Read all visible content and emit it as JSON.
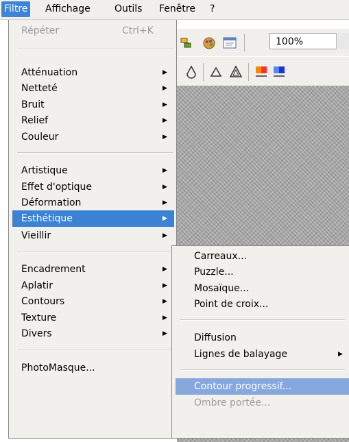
{
  "menubar": {
    "items": [
      "Filtre",
      "Affichage",
      "Outils",
      "Fenêtre",
      "?"
    ]
  },
  "toolbar": {
    "zoom": "100%"
  },
  "filter_menu": {
    "repeat": {
      "label": "Répéter",
      "shortcut": "Ctrl+K"
    },
    "items": [
      "Atténuation",
      "Netteté",
      "Bruit",
      "Relief",
      "Couleur",
      "Artistique",
      "Effet d'optique",
      "Déformation",
      "Esthétique",
      "Vieillir",
      "Encadrement",
      "Aplatir",
      "Contours",
      "Texture",
      "Divers",
      "PhotoMasque..."
    ]
  },
  "esthetique_submenu": {
    "items": [
      "Carreaux...",
      "Puzzle...",
      "Mosaïque...",
      "Point de croix...",
      "Diffusion",
      "Lignes de balayage",
      "Contour progressif...",
      "Ombre portée..."
    ]
  },
  "colors": {
    "highlight": "#3c83d3",
    "submenu_highlight": "#87a8dc",
    "menu_bg": "#f1f0ec",
    "disabled_text": "#9d9d9d"
  }
}
